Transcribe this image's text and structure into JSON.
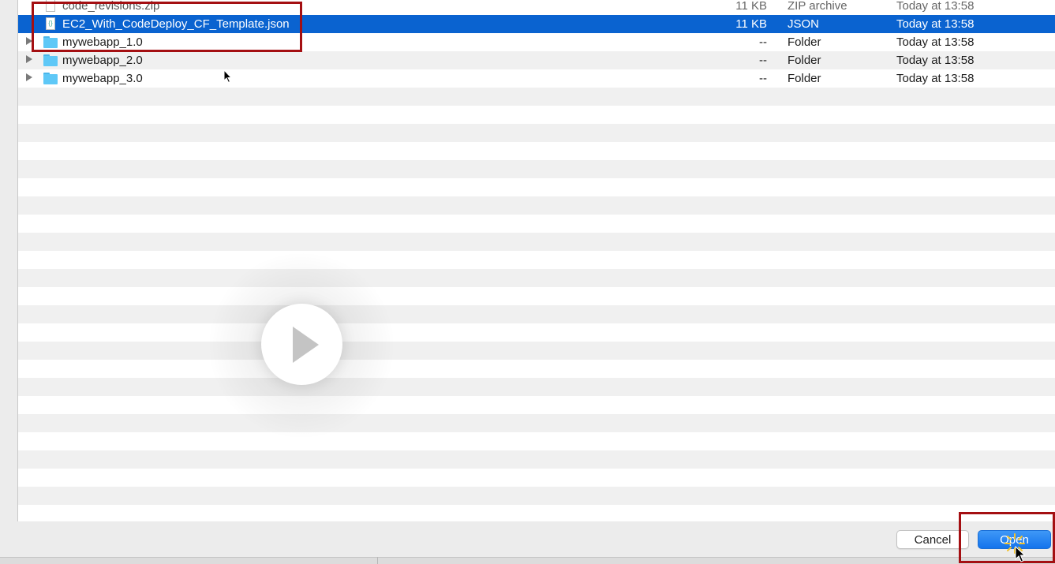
{
  "files": [
    {
      "name": "code_revisions.zip",
      "size": "11 KB",
      "kind": "ZIP archive",
      "date": "Today at 13:58",
      "type": "file"
    },
    {
      "name": "EC2_With_CodeDeploy_CF_Template.json",
      "size": "11 KB",
      "kind": "JSON",
      "date": "Today at 13:58",
      "type": "file",
      "selected": true
    },
    {
      "name": "mywebapp_1.0",
      "size": "--",
      "kind": "Folder",
      "date": "Today at 13:58",
      "type": "folder"
    },
    {
      "name": "mywebapp_2.0",
      "size": "--",
      "kind": "Folder",
      "date": "Today at 13:58",
      "type": "folder"
    },
    {
      "name": "mywebapp_3.0",
      "size": "--",
      "kind": "Folder",
      "date": "Today at 13:58",
      "type": "folder"
    }
  ],
  "buttons": {
    "cancel": "Cancel",
    "open": "Open"
  },
  "icons": {
    "file": "document-icon",
    "json": "json-document-icon",
    "folder": "folder-icon",
    "play": "play-icon"
  },
  "colors": {
    "selection": "#0a63d0",
    "annotation": "#a40f12",
    "primary_button": "#1474ec",
    "folder": "#5ec8f7"
  }
}
